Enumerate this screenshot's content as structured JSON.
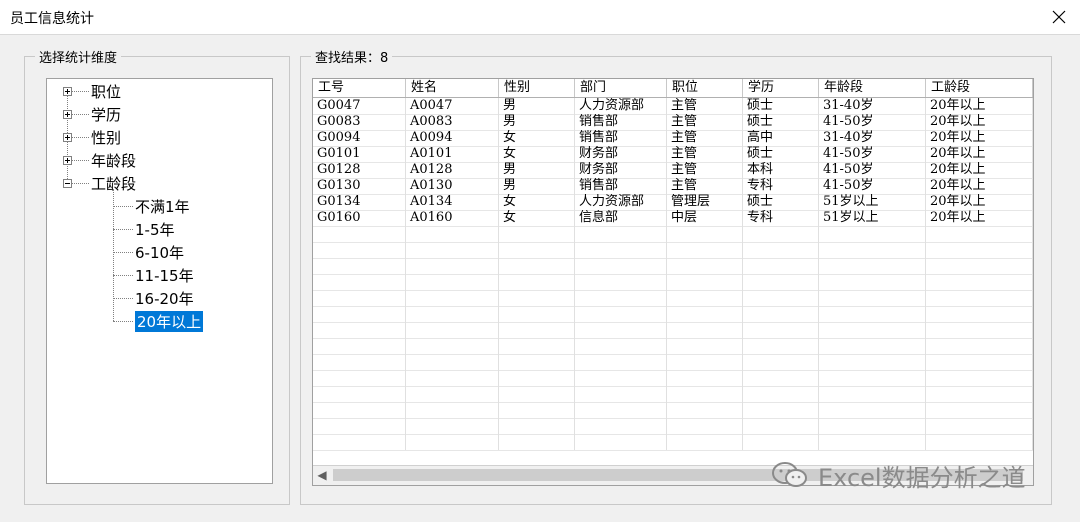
{
  "window": {
    "title": "员工信息统计"
  },
  "left_panel": {
    "legend": "选择统计维度",
    "tree": [
      {
        "label": "职位",
        "expanded": false
      },
      {
        "label": "学历",
        "expanded": false
      },
      {
        "label": "性别",
        "expanded": false
      },
      {
        "label": "年龄段",
        "expanded": false
      },
      {
        "label": "工龄段",
        "expanded": true,
        "children": [
          "不满1年",
          "1-5年",
          "6-10年",
          "11-15年",
          "16-20年",
          "20年以上"
        ],
        "selected_child": "20年以上"
      }
    ]
  },
  "right_panel": {
    "legend": "查找结果：8",
    "columns": [
      "工号",
      "姓名",
      "性别",
      "部门",
      "职位",
      "学历",
      "年龄段",
      "工龄段"
    ],
    "rows": [
      [
        "G0047",
        "A0047",
        "男",
        "人力资源部",
        "主管",
        "硕士",
        "31-40岁",
        "20年以上"
      ],
      [
        "G0083",
        "A0083",
        "男",
        "销售部",
        "主管",
        "硕士",
        "41-50岁",
        "20年以上"
      ],
      [
        "G0094",
        "A0094",
        "女",
        "销售部",
        "主管",
        "高中",
        "31-40岁",
        "20年以上"
      ],
      [
        "G0101",
        "A0101",
        "女",
        "财务部",
        "主管",
        "硕士",
        "41-50岁",
        "20年以上"
      ],
      [
        "G0128",
        "A0128",
        "男",
        "财务部",
        "主管",
        "本科",
        "41-50岁",
        "20年以上"
      ],
      [
        "G0130",
        "A0130",
        "男",
        "销售部",
        "主管",
        "专科",
        "41-50岁",
        "20年以上"
      ],
      [
        "G0134",
        "A0134",
        "女",
        "人力资源部",
        "管理层",
        "硕士",
        "51岁以上",
        "20年以上"
      ],
      [
        "G0160",
        "A0160",
        "女",
        "信息部",
        "中层",
        "专科",
        "51岁以上",
        "20年以上"
      ]
    ]
  },
  "watermark": {
    "text": "Excel数据分析之道",
    "icon": "wechat-icon"
  }
}
